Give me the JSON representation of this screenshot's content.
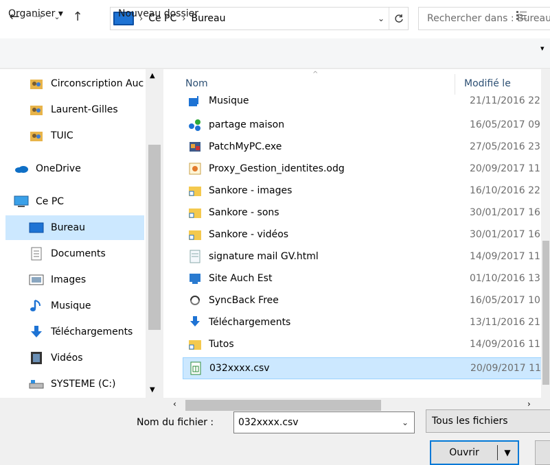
{
  "address": {
    "crumbs": [
      "Ce PC",
      "Bureau"
    ],
    "search_placeholder": "Rechercher dans : Bureau"
  },
  "toolbar": {
    "organize": "Organiser ▾",
    "new_folder": "Nouveau dossier"
  },
  "nav": {
    "items": [
      {
        "label": "Circonscription Auch",
        "icon": "users-icon"
      },
      {
        "label": "Laurent-Gilles",
        "icon": "users-icon"
      },
      {
        "label": "TUIC",
        "icon": "users-icon"
      },
      {
        "label": "OneDrive",
        "icon": "cloud-icon"
      },
      {
        "label": "Ce PC",
        "icon": "pc-icon"
      },
      {
        "label": "Bureau",
        "icon": "desktop-icon"
      },
      {
        "label": "Documents",
        "icon": "document-icon"
      },
      {
        "label": "Images",
        "icon": "images-icon"
      },
      {
        "label": "Musique",
        "icon": "music-icon"
      },
      {
        "label": "Téléchargements",
        "icon": "download-icon"
      },
      {
        "label": "Vidéos",
        "icon": "video-icon"
      },
      {
        "label": "SYSTEME (C:)",
        "icon": "drive-icon"
      }
    ]
  },
  "filelist": {
    "columns": {
      "name": "Nom",
      "modified": "Modifié le"
    },
    "rows": [
      {
        "name": "Musique",
        "date": "21/11/2016 22:",
        "icon": "music-folder-icon"
      },
      {
        "name": "partage maison",
        "date": "16/05/2017 09",
        "icon": "share-icon"
      },
      {
        "name": "PatchMyPC.exe",
        "date": "27/05/2016 23",
        "icon": "exe-icon"
      },
      {
        "name": "Proxy_Gestion_identites.odg",
        "date": "20/09/2017 11",
        "icon": "odg-icon"
      },
      {
        "name": "Sankore - images",
        "date": "16/10/2016 22",
        "icon": "shortcut-folder-icon"
      },
      {
        "name": "Sankore - sons",
        "date": "30/01/2017 16",
        "icon": "shortcut-folder-icon"
      },
      {
        "name": "Sankore - vidéos",
        "date": "30/01/2017 16",
        "icon": "shortcut-folder-icon"
      },
      {
        "name": "signature mail GV.html",
        "date": "14/09/2017 11",
        "icon": "html-icon"
      },
      {
        "name": "Site Auch Est",
        "date": "01/10/2016 13",
        "icon": "site-icon"
      },
      {
        "name": "SyncBack Free",
        "date": "16/05/2017 10",
        "icon": "sync-icon"
      },
      {
        "name": "Téléchargements",
        "date": "13/11/2016 21",
        "icon": "download-shortcut-icon"
      },
      {
        "name": "Tutos",
        "date": "14/09/2016 11",
        "icon": "shortcut-folder-icon"
      },
      {
        "name": "032xxxx.csv",
        "date": "20/09/2017 11",
        "icon": "csv-icon",
        "selected": true
      }
    ]
  },
  "bottom": {
    "filename_label": "Nom du fichier :",
    "filename_value": "032xxxx.csv",
    "filter": "Tous les fichiers",
    "open_label": "Ouvrir"
  }
}
